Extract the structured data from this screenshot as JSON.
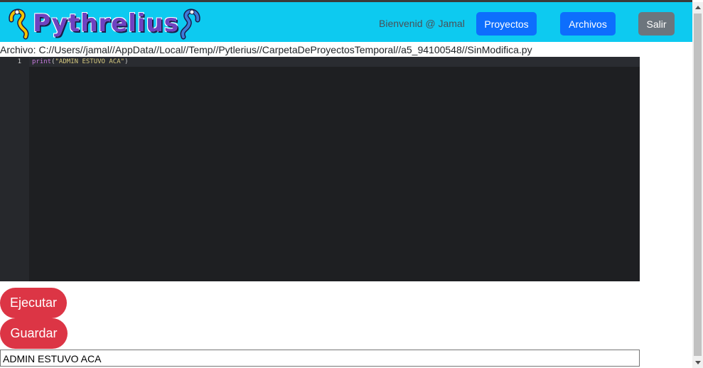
{
  "header": {
    "logo_text": "Pythrelius",
    "welcome": "Bienvenid @ Jamal",
    "projects_label": "Proyectos",
    "files_label": "Archivos",
    "exit_label": "Salir"
  },
  "file": {
    "path_label": "Archivo: C://Users//jamal//AppData//Local//Temp//Pytlerius//CarpetaDeProyectosTemporal//a5_94100548//SinModifica.py"
  },
  "editor": {
    "line_number": "1",
    "code_fn": "print",
    "code_open": "(",
    "code_string": "\"ADMIN ESTUVO ACA\"",
    "code_close": ")"
  },
  "actions": {
    "run_label": "Ejecutar",
    "save_label": "Guardar"
  },
  "output": {
    "text": "ADMIN ESTUVO ACA"
  },
  "colors": {
    "navbar": "#0dcaf0",
    "primary": "#0d6efd",
    "secondary": "#6c757d",
    "danger": "#dc3545",
    "editor_bg": "#1e1f22"
  }
}
